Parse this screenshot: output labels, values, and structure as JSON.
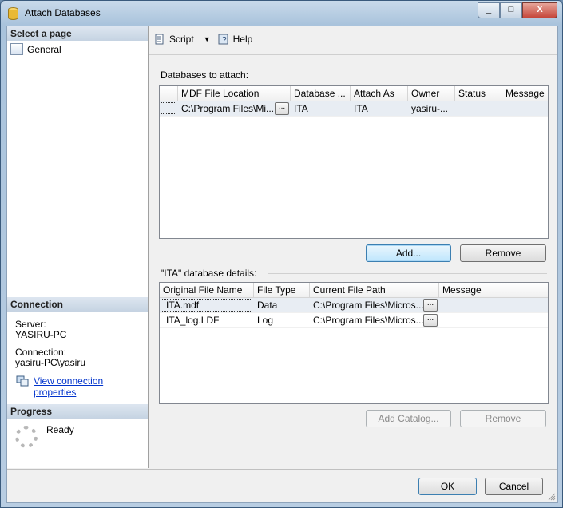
{
  "window": {
    "title": "Attach Databases",
    "close_label": "X",
    "minimize_label": "_",
    "maximize_label": "□"
  },
  "sidebar": {
    "select_page_header": "Select a page",
    "pages": [
      {
        "label": "General"
      }
    ],
    "connection_header": "Connection",
    "server_label": "Server:",
    "server_value": "YASIRU-PC",
    "connection_label": "Connection:",
    "connection_value": "yasiru-PC\\yasiru",
    "view_connection_link": "View connection properties",
    "progress_header": "Progress",
    "progress_status": "Ready"
  },
  "toolbar": {
    "script_label": "Script",
    "help_label": "Help"
  },
  "databases": {
    "section_label": "Databases to attach:",
    "columns": [
      "MDF File Location",
      "Database ...",
      "Attach As",
      "Owner",
      "Status",
      "Message"
    ],
    "rows": [
      {
        "mdf": "C:\\Program Files\\Mi...",
        "database": "ITA",
        "attach_as": "ITA",
        "owner": "yasiru-...",
        "status": "",
        "message": ""
      }
    ],
    "add_button": "Add...",
    "remove_button": "Remove"
  },
  "details": {
    "section_label": "\"ITA\" database details:",
    "columns": [
      "Original File Name",
      "File Type",
      "Current File Path",
      "Message"
    ],
    "rows": [
      {
        "name": "ITA.mdf",
        "type": "Data",
        "path": "C:\\Program Files\\Micros...",
        "message": ""
      },
      {
        "name": "ITA_log.LDF",
        "type": "Log",
        "path": "C:\\Program Files\\Micros...",
        "message": ""
      }
    ],
    "add_catalog_button": "Add Catalog...",
    "remove_button": "Remove"
  },
  "footer": {
    "ok_button": "OK",
    "cancel_button": "Cancel"
  },
  "ellipsis": "..."
}
